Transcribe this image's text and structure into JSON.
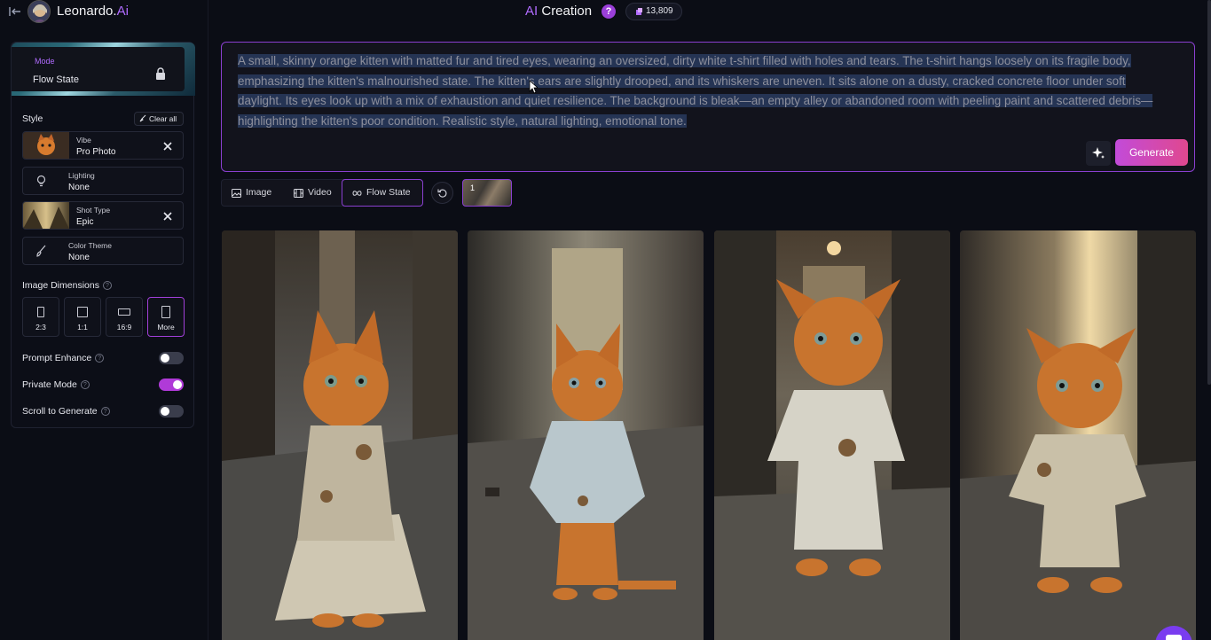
{
  "header": {
    "brand_name": "Leonardo.",
    "brand_suffix": "Ai",
    "title_prefix": "AI",
    "title_main": " Creation",
    "help_label": "?",
    "token_count": "13,809"
  },
  "sidebar": {
    "mode_label": "Mode",
    "mode_value": "Flow State",
    "style_label": "Style",
    "clear_all_label": "Clear all",
    "style_rows": [
      {
        "label": "Vibe",
        "value": "Pro Photo"
      },
      {
        "label": "Lighting",
        "value": "None"
      },
      {
        "label": "Shot Type",
        "value": "Epic"
      },
      {
        "label": "Color Theme",
        "value": "None"
      }
    ],
    "dimensions_label": "Image Dimensions",
    "dimensions": [
      {
        "label": "2:3",
        "selected": false
      },
      {
        "label": "1:1",
        "selected": false
      },
      {
        "label": "16:9",
        "selected": false
      },
      {
        "label": "More",
        "selected": true
      }
    ],
    "toggles": [
      {
        "label": "Prompt Enhance",
        "on": false
      },
      {
        "label": "Private Mode",
        "on": true
      },
      {
        "label": "Scroll to Generate",
        "on": false
      }
    ]
  },
  "prompt": {
    "text": "A small, skinny orange kitten with matted fur and tired eyes, wearing an oversized, dirty white t-shirt filled with holes and tears. The t-shirt hangs loosely on its fragile body, emphasizing the kitten's malnourished state. The kitten's ears are slightly drooped, and its whiskers are uneven. It sits alone on a dusty, cracked concrete floor under soft daylight. Its eyes look up with a mix of exhaustion and quiet resilience. The background is bleak—an empty alley or abandoned room with peeling paint and scattered debris—highlighting the kitten's poor condition. Realistic style, natural lighting, emotional tone.",
    "generate_label": "Generate"
  },
  "tabs": [
    {
      "label": "Image",
      "icon": "image-icon",
      "active": false
    },
    {
      "label": "Video",
      "icon": "video-icon",
      "active": false
    },
    {
      "label": "Flow State",
      "icon": "infinity-icon",
      "active": true
    }
  ],
  "queue": {
    "count": "1"
  },
  "colors": {
    "accent": "#b06bff",
    "generate_start": "#c24bd9",
    "generate_end": "#e0488f",
    "selection": "#253454"
  }
}
